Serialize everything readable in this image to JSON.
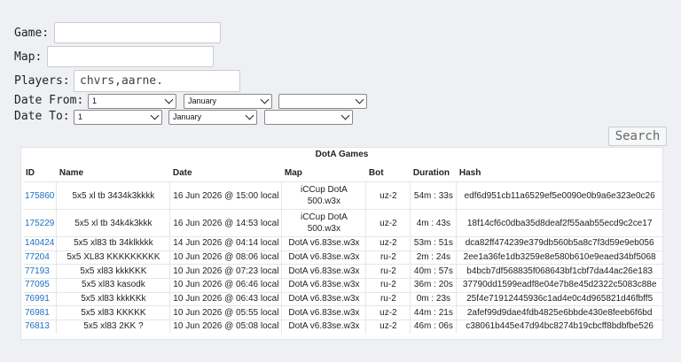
{
  "form": {
    "game_label": "Game:",
    "game_value": "",
    "map_label": "Map:",
    "map_value": "",
    "players_label": "Players:",
    "players_value": "chvrs,aarne.",
    "date_from_label": "Date From:",
    "date_from_day": "1",
    "date_from_month": "January",
    "date_from_year": "",
    "date_to_label": "Date To:",
    "date_to_day": "1",
    "date_to_month": "January",
    "date_to_year": "",
    "search_label": "Search"
  },
  "table": {
    "caption": "DotA Games",
    "headers": [
      "ID",
      "Name",
      "Date",
      "Map",
      "Bot",
      "Duration",
      "Hash"
    ],
    "rows": [
      {
        "id": "175860",
        "name": "5x5 xl tb 3434k3kkkk",
        "date": "16 Jun 2026 @ 15:00 local",
        "map": "iCCup DotA 500.w3x",
        "bot": "uz-2",
        "duration": "54m : 33s",
        "hash": "edf6d951cb11a6529ef5e0090e0b9a6e323e0c26"
      },
      {
        "id": "175229",
        "name": "5x5 xl tb 34k4k3kkk",
        "date": "16 Jun 2026 @ 14:53 local",
        "map": "iCCup DotA 500.w3x",
        "bot": "uz-2",
        "duration": "4m : 43s",
        "hash": "18f14cf6c0dba35d8deaf2f55aab55ecd9c2ce17"
      },
      {
        "id": "140424",
        "name": "5x5 xl83 tb 34klkkkk",
        "date": "14 Jun 2026 @ 04:14 local",
        "map": "DotA v6.83se.w3x",
        "bot": "uz-2",
        "duration": "53m : 51s",
        "hash": "dca82ff474239e379db560b5a8c7f3d59e9eb056"
      },
      {
        "id": "77204",
        "name": "5x5 XL83 KKKKKKKKK",
        "date": "10 Jun 2026 @ 08:06 local",
        "map": "DotA v6.83se.w3x",
        "bot": "ru-2",
        "duration": "2m : 24s",
        "hash": "2ee1a36fe1db3259e8e580b610e9eaed34bf5068"
      },
      {
        "id": "77193",
        "name": "5x5 xl83 kkkKKK",
        "date": "10 Jun 2026 @ 07:23 local",
        "map": "DotA v6.83se.w3x",
        "bot": "ru-2",
        "duration": "40m : 57s",
        "hash": "b4bcb7df568835f068643bf1cbf7da44ac26e183"
      },
      {
        "id": "77095",
        "name": "5x5 xl83 kasodk",
        "date": "10 Jun 2026 @ 06:46 local",
        "map": "DotA v6.83se.w3x",
        "bot": "ru-2",
        "duration": "36m : 20s",
        "hash": "37790dd1599eadf8e04e7b8e45d2322c5083c88e"
      },
      {
        "id": "76991",
        "name": "5x5 xl83 kkkKKk",
        "date": "10 Jun 2026 @ 06:43 local",
        "map": "DotA v6.83se.w3x",
        "bot": "ru-2",
        "duration": "0m : 23s",
        "hash": "25f4e71912445936c1ad4e0c4d965821d46fbff5"
      },
      {
        "id": "76981",
        "name": "5x5 xl83 KKKKK",
        "date": "10 Jun 2026 @ 05:55 local",
        "map": "DotA v6.83se.w3x",
        "bot": "uz-2",
        "duration": "44m : 21s",
        "hash": "2afef99d9dae4fdb4825e6bbde430e8feeb6f6bd"
      },
      {
        "id": "76813",
        "name": "5x5 xl83 2KK ?",
        "date": "10 Jun 2026 @ 05:08 local",
        "map": "DotA v6.83se.w3x",
        "bot": "uz-2",
        "duration": "46m : 06s",
        "hash": "c38061b445e47d94bc8274b19cbcff8bdbfbe526"
      }
    ]
  },
  "colors": {
    "link": "#1a6fc4",
    "background": "#eef0f3"
  }
}
